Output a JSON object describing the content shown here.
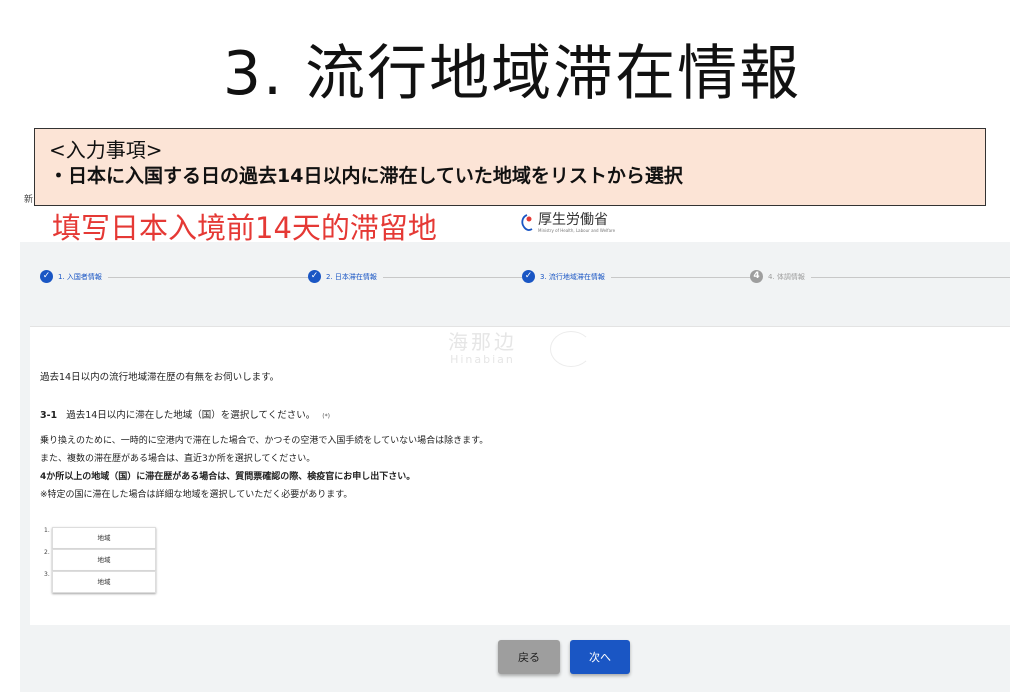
{
  "slide": {
    "title": "3. 流行地域滞在情報"
  },
  "info_box": {
    "heading": "<入力事項>",
    "text": "・日本に入国する日の過去14日以内に滞在していた地域をリストから選択"
  },
  "caption": {
    "text": "填写日本入境前14天的滞留地"
  },
  "header": {
    "cutoff_char": "新",
    "logo_name": "厚生労働省",
    "logo_english": "Ministry of Health, Labour and Welfare"
  },
  "stepper": {
    "steps": [
      {
        "label": "1. 入国者情報",
        "state": "done"
      },
      {
        "label": "2. 日本滞在情報",
        "state": "done"
      },
      {
        "label": "3. 流行地域滞在情報",
        "state": "current"
      },
      {
        "label": "4. 体調情報",
        "state": "todo"
      }
    ],
    "check_glyph": "✓",
    "todo_glyph": "4"
  },
  "watermark": {
    "cn": "海那边",
    "en": "Hinabian"
  },
  "question": {
    "intro": "過去14日以内の流行地域滞在歴の有無をお伺いします。",
    "number": "3-1",
    "title": "過去14日以内に滞在した地域（国）を選択してください。",
    "required_mark": "(*)",
    "notes": [
      "乗り換えのために、一時的に空港内で滞在した場合で、かつその空港で入国手続をしていない場合は除きます。",
      "また、複数の滞在歴がある場合は、直近3か所を選択してください。",
      "4か所以上の地域（国）に滞在歴がある場合は、質問票確認の際、検疫官にお申し出下さい。",
      "※特定の国に滞在した場合は詳細な地域を選択していただく必要があります。"
    ]
  },
  "regions": [
    {
      "num": "1.",
      "placeholder": "地域"
    },
    {
      "num": "2.",
      "placeholder": "地域"
    },
    {
      "num": "3.",
      "placeholder": "地域"
    }
  ],
  "buttons": {
    "back": "戻る",
    "next": "次へ"
  },
  "colors": {
    "primary": "#1a56c4",
    "secondary_button": "#9e9e9e",
    "info_box_bg": "#fce4d6",
    "caption_red": "#e53935"
  }
}
